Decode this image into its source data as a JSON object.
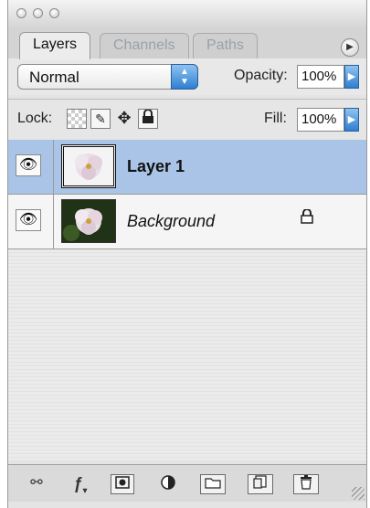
{
  "window": {
    "tabs": [
      "Layers",
      "Channels",
      "Paths"
    ],
    "active_tab": "Layers",
    "menu_icon": "panel-menu-icon"
  },
  "options": {
    "blend_mode": "Normal",
    "opacity_label": "Opacity:",
    "opacity_value": "100%",
    "lock_label": "Lock:",
    "fill_label": "Fill:",
    "fill_value": "100%"
  },
  "layers": [
    {
      "name": "Layer 1",
      "selected": true,
      "visible": true,
      "locked": false
    },
    {
      "name": "Background",
      "selected": false,
      "visible": true,
      "locked": true
    }
  ],
  "colors": {
    "selection": "#a9c4e6",
    "accent_blue": "#2f7fd2"
  },
  "bottom_icons": [
    "link-icon",
    "layer-style-icon",
    "mask-icon",
    "adjustment-layer-icon",
    "new-group-icon",
    "new-layer-icon",
    "trash-icon"
  ]
}
